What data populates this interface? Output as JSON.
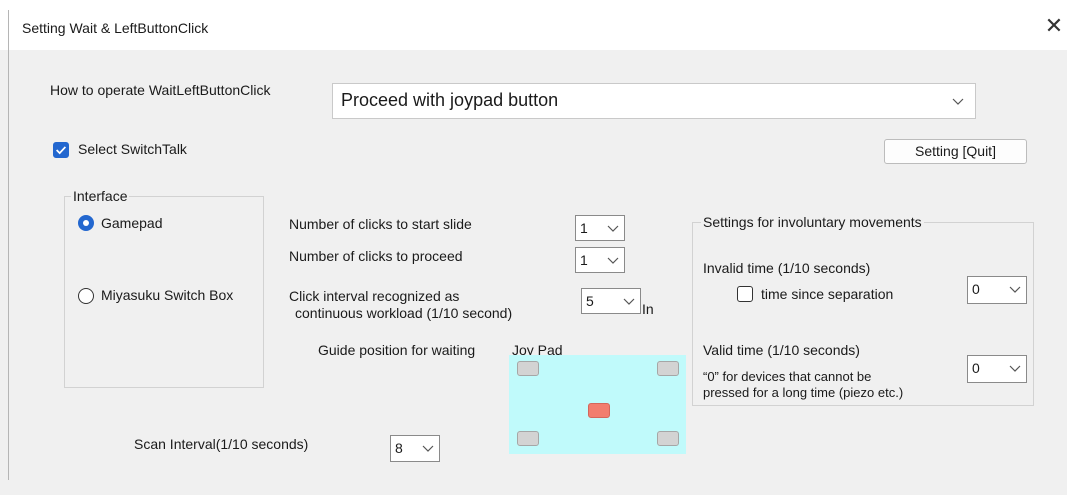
{
  "window": {
    "title": "Setting Wait & LeftButtonClick",
    "close_glyph": "✕"
  },
  "operation": {
    "label": "How to operate WaitLeftButtonClick",
    "value": "Proceed with joypad button"
  },
  "switchtalk": {
    "label": "Select SwitchTalk",
    "checked": true
  },
  "setting_button": {
    "label": "Setting [Quit]"
  },
  "interface": {
    "legend": "Interface",
    "options": [
      {
        "label": "Gamepad",
        "selected": true
      },
      {
        "label": "Miyasuku Switch Box",
        "selected": false
      }
    ]
  },
  "clicks": {
    "start_label": "Number of clicks to start slide",
    "start_value": "1",
    "proceed_label": "Number of clicks to proceed",
    "proceed_value": "1",
    "interval_label_line1": "Click interval recognized as",
    "interval_label_line2": "continuous workload (1/10 second)",
    "interval_value": "5",
    "interval_unit": "In"
  },
  "guide": {
    "label": "Guide position for waiting",
    "joypad_label": "Joy Pad",
    "pad_color": "#c0fafb",
    "active_color": "#f27d6e",
    "active_position": "center"
  },
  "involuntary": {
    "legend": "Settings for involuntary movements",
    "invalid_label": "Invalid time (1/10 seconds)",
    "separation_label": "time since separation",
    "separation_checked": false,
    "invalid_value": "0",
    "valid_label": "Valid time (1/10 seconds)",
    "note_line1": "“0” for devices that cannot be",
    "note_line2": "pressed for a long time (piezo etc.)",
    "valid_value": "0"
  },
  "scan": {
    "label": "Scan Interval(1/10 seconds)",
    "value": "8"
  },
  "icons": {
    "close": "close-icon",
    "chevron": "chevron-down-icon",
    "check": "checkmark-icon"
  }
}
